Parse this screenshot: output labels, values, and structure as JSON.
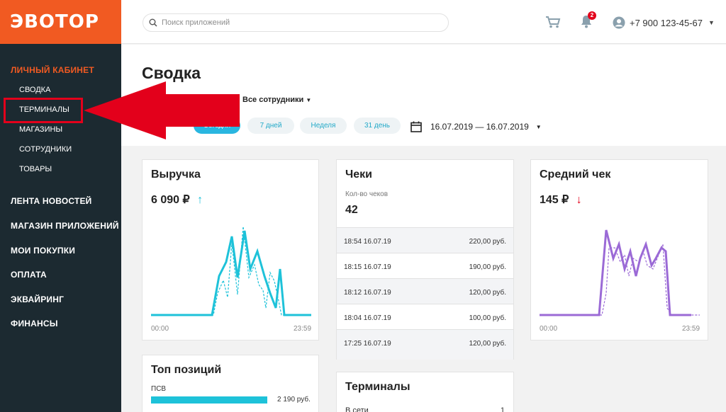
{
  "logo": "ЭВОТОР",
  "header": {
    "search_placeholder": "Поиск приложений",
    "notifications_count": "2",
    "phone": "+7 900 123-45-67"
  },
  "sidebar": {
    "section_cabinet": "ЛИЧНЫЙ КАБИНЕТ",
    "sub": [
      "СВОДКА",
      "ТЕРМИНАЛЫ",
      "МАГАЗИНЫ",
      "СОТРУДНИКИ",
      "ТОВАРЫ"
    ],
    "sections": [
      "ЛЕНТА НОВОСТЕЙ",
      "МАГАЗИН ПРИЛОЖЕНИЙ",
      "МОИ ПОКУПКИ",
      "ОПЛАТА",
      "ЭКВАЙРИНГ",
      "ФИНАНСЫ"
    ]
  },
  "page": {
    "title": "Сводка",
    "employees_filter": "Все сотрудники",
    "periods": [
      "Сегодня",
      "7 дней",
      "Неделя",
      "31 день"
    ],
    "date_range": "16.07.2019 — 16.07.2019"
  },
  "revenue": {
    "title": "Выручка",
    "value": "6 090 ₽",
    "axis_start": "00:00",
    "axis_end": "23:59",
    "color": "#1ec2d9"
  },
  "checks": {
    "title": "Чеки",
    "count_label": "Кол-во чеков",
    "count": "42",
    "rows": [
      {
        "time": "18:54 16.07.19",
        "amount": "220,00 руб."
      },
      {
        "time": "18:15 16.07.19",
        "amount": "190,00 руб."
      },
      {
        "time": "18:12 16.07.19",
        "amount": "120,00 руб."
      },
      {
        "time": "18:04 16.07.19",
        "amount": "100,00 руб."
      },
      {
        "time": "17:25 16.07.19",
        "amount": "120,00 руб."
      }
    ]
  },
  "avg_check": {
    "title": "Средний чек",
    "value": "145 ₽",
    "axis_start": "00:00",
    "axis_end": "23:59",
    "color": "#9b6ad6"
  },
  "top_positions": {
    "title": "Топ позиций",
    "item_name": "ПСВ",
    "item_value": "2 190 руб."
  },
  "terminals": {
    "title": "Терминалы",
    "row_label": "В сети",
    "row_value": "1"
  }
}
